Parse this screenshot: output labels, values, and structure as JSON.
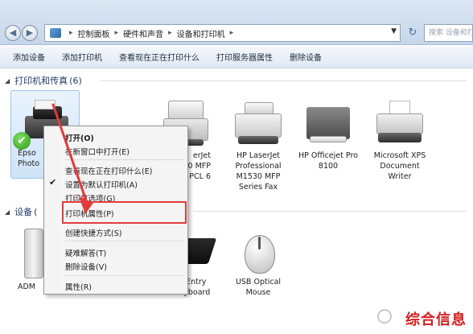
{
  "address": {
    "crumbs": [
      "控制面板",
      "硬件和声音",
      "设备和打印机"
    ],
    "search_placeholder": "搜索 设备和打印机"
  },
  "toolbar": {
    "items": [
      "添加设备",
      "添加打印机",
      "查看现在正在打印什么",
      "打印服务器属性",
      "删除设备"
    ]
  },
  "groups": {
    "printers": {
      "label": "打印机和传真",
      "count": "(6)"
    },
    "devices": {
      "label": "设备",
      "count": "("
    }
  },
  "printers": [
    {
      "name_line1": "Epso",
      "name_line2": "Photo"
    },
    {
      "name_line1": "erJet",
      "name_line2": "0 MFP",
      "name_line3": "PCL 6"
    },
    {
      "name_line1": "HP LaserJet",
      "name_line2": "Professional",
      "name_line3": "M1530 MFP",
      "name_line4": "Series Fax"
    },
    {
      "name_line1": "HP Officejet Pro",
      "name_line2": "8100"
    },
    {
      "name_line1": "Microsoft XPS",
      "name_line2": "Document",
      "name_line3": "Writer"
    }
  ],
  "devices": [
    {
      "name": "ADM"
    },
    {
      "name_line1": "B Entry",
      "name_line2": "Keyboard"
    },
    {
      "name_line1": "USB Optical",
      "name_line2": "Mouse"
    }
  ],
  "context_menu": {
    "items": [
      "打开(O)",
      "在新窗口中打开(E)",
      "查看现在正在打印什么(E)",
      "设置为默认打印机(A)",
      "打印首选项(G)",
      "打印机属性(P)",
      "创建快捷方式(S)",
      "疑难解答(T)",
      "删除设备(V)",
      "属性(R)"
    ]
  },
  "watermark": {
    "text": "综合信息"
  },
  "colors": {
    "highlight": "#e23b3b",
    "accent": "#1e3b67"
  }
}
